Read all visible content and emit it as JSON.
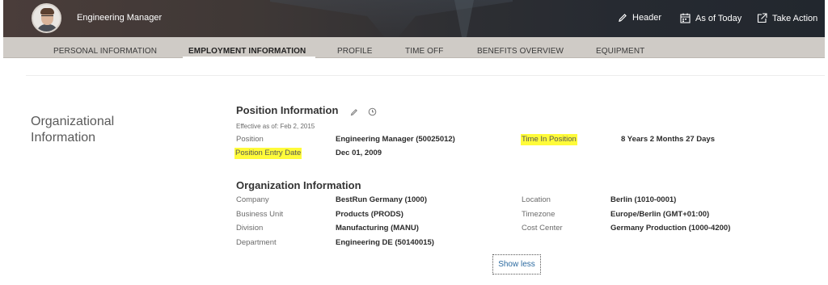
{
  "header": {
    "role_title": "Engineering Manager",
    "actions": [
      {
        "label": "Header",
        "icon": "pencil-icon"
      },
      {
        "label": "As of Today",
        "icon": "calendar-icon"
      },
      {
        "label": "Take Action",
        "icon": "external-action-icon"
      }
    ]
  },
  "tabs": [
    {
      "label": "PERSONAL INFORMATION",
      "active": false
    },
    {
      "label": "EMPLOYMENT INFORMATION",
      "active": true
    },
    {
      "label": "PROFILE",
      "active": false
    },
    {
      "label": "TIME OFF",
      "active": false
    },
    {
      "label": "BENEFITS OVERVIEW",
      "active": false
    },
    {
      "label": "EQUIPMENT",
      "active": false
    }
  ],
  "section": {
    "title_line1": "Organizational",
    "title_line2": "Information"
  },
  "position_info": {
    "header": "Position Information",
    "effective": "Effective as of: Feb 2, 2015",
    "position_label": "Position",
    "position_value": "Engineering Manager (50025012)",
    "time_in_position_label": "Time In Position",
    "time_in_position_value": "8 Years 2 Months 27 Days",
    "entry_date_label": "Position Entry Date",
    "entry_date_value": "Dec 01, 2009"
  },
  "org_info": {
    "header": "Organization Information",
    "company_label": "Company",
    "company_value": "BestRun Germany (1000)",
    "business_unit_label": "Business Unit",
    "business_unit_value": "Products (PRODS)",
    "division_label": "Division",
    "division_value": "Manufacturing (MANU)",
    "department_label": "Department",
    "department_value": "Engineering DE (50140015)",
    "location_label": "Location",
    "location_value": "Berlin (1010-0001)",
    "timezone_label": "Timezone",
    "timezone_value": "Europe/Berlin (GMT+01:00)",
    "cost_center_label": "Cost Center",
    "cost_center_value": "Germany Production (1000-4200)"
  },
  "show_less_label": "Show less",
  "colors": {
    "highlight": "#fffb3a",
    "tabbar": "#cfcbc6",
    "link": "#2b6aa0"
  }
}
